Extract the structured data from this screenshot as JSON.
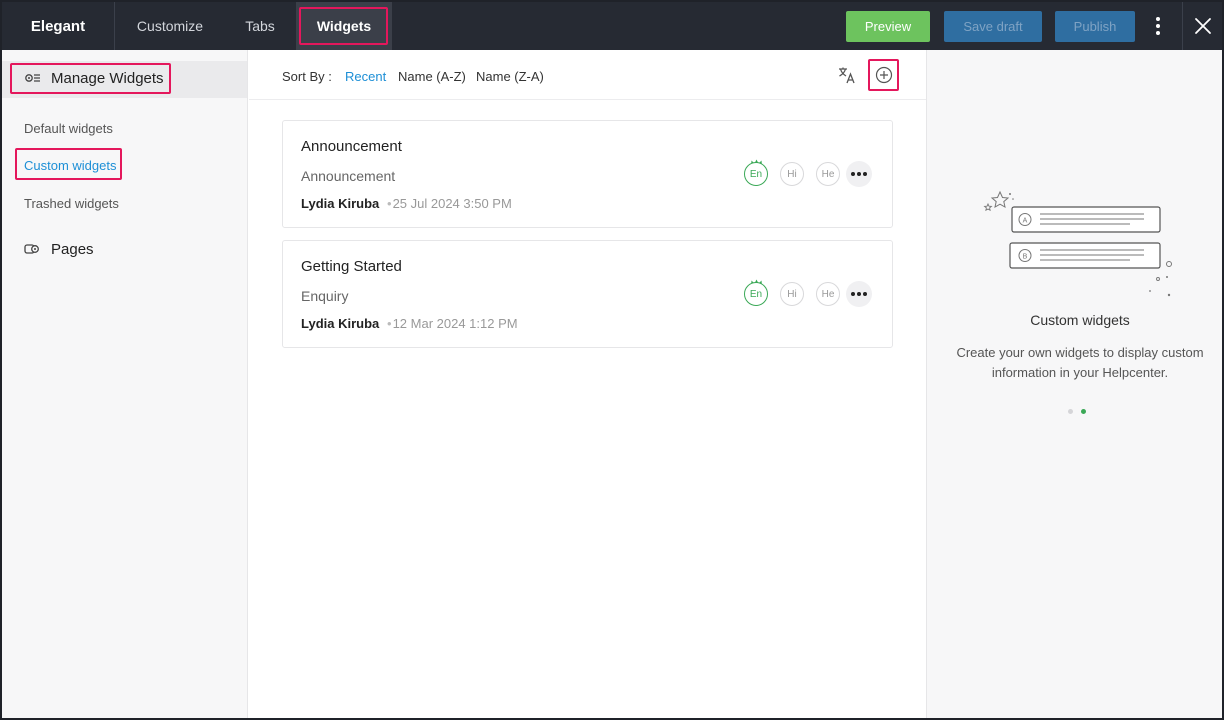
{
  "topbar": {
    "brand": "Elegant",
    "tabs": [
      {
        "label": "Customize"
      },
      {
        "label": "Tabs"
      },
      {
        "label": "Widgets"
      }
    ],
    "preview_label": "Preview",
    "save_draft_label": "Save draft",
    "publish_label": "Publish",
    "icons": [
      "more-vertical-icon",
      "close-icon"
    ]
  },
  "sidebar": {
    "manage_widgets": "Manage Widgets",
    "items": [
      {
        "label": "Default widgets"
      },
      {
        "label": "Custom widgets",
        "active": true
      },
      {
        "label": "Trashed widgets"
      }
    ],
    "pages": "Pages"
  },
  "main": {
    "sort_label": "Sort By :",
    "sort_options": [
      {
        "label": "Recent",
        "active": true
      },
      {
        "label": "Name (A-Z)"
      },
      {
        "label": "Name (Z-A)"
      }
    ],
    "icons": [
      "translate-icon",
      "add-circle-icon"
    ],
    "widgets": [
      {
        "title": "Announcement",
        "type": "Announcement",
        "author": "Lydia Kiruba",
        "date": "25 Jul 2024 3:50 PM",
        "languages": [
          "En",
          "Hi",
          "He"
        ]
      },
      {
        "title": "Getting Started",
        "type": "Enquiry",
        "author": "Lydia Kiruba",
        "date": "12 Mar 2024 1:12 PM",
        "languages": [
          "En",
          "Hi",
          "He"
        ]
      }
    ]
  },
  "right_panel": {
    "title": "Custom widgets",
    "description": "Create your own widgets to display custom information in your Helpcenter.",
    "carousel": {
      "total": 2,
      "active": 2
    }
  },
  "colors": {
    "topbar_bg": "#262a33",
    "accent_blue": "#1d8fd6",
    "highlight": "#e4175c",
    "preview_green": "#6dc35e",
    "lang_green": "#3aa856"
  }
}
